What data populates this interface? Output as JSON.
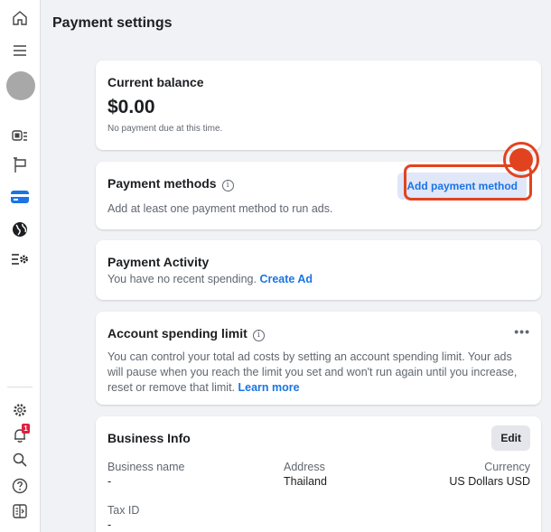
{
  "page": {
    "title": "Payment settings"
  },
  "balance": {
    "title": "Current balance",
    "amount": "$0.00",
    "note": "No payment due at this time."
  },
  "methods": {
    "title": "Payment methods",
    "info": "i",
    "button": "Add payment method",
    "description": "Add at least one payment method to run ads."
  },
  "activity": {
    "title": "Payment Activity",
    "text": "You have no recent spending.",
    "link": "Create Ad"
  },
  "limit": {
    "title": "Account spending limit",
    "info": "i",
    "more": "•••",
    "text": "You can control your total ad costs by setting an account spending limit. Your ads will pause when you reach the limit you set and won't run again until you increase, reset or remove that limit.",
    "link": "Learn more"
  },
  "business": {
    "title": "Business Info",
    "edit": "Edit",
    "name_label": "Business name",
    "name_value": "-",
    "address_label": "Address",
    "address_value": "Thailand",
    "currency_label": "Currency",
    "currency_value": "US Dollars USD",
    "tax_label": "Tax ID",
    "tax_value": "-"
  },
  "rail": {
    "notification_count": "1"
  },
  "colors": {
    "accent": "#1b74e4",
    "highlight": "#e2431f",
    "badge": "#e41e3f"
  }
}
